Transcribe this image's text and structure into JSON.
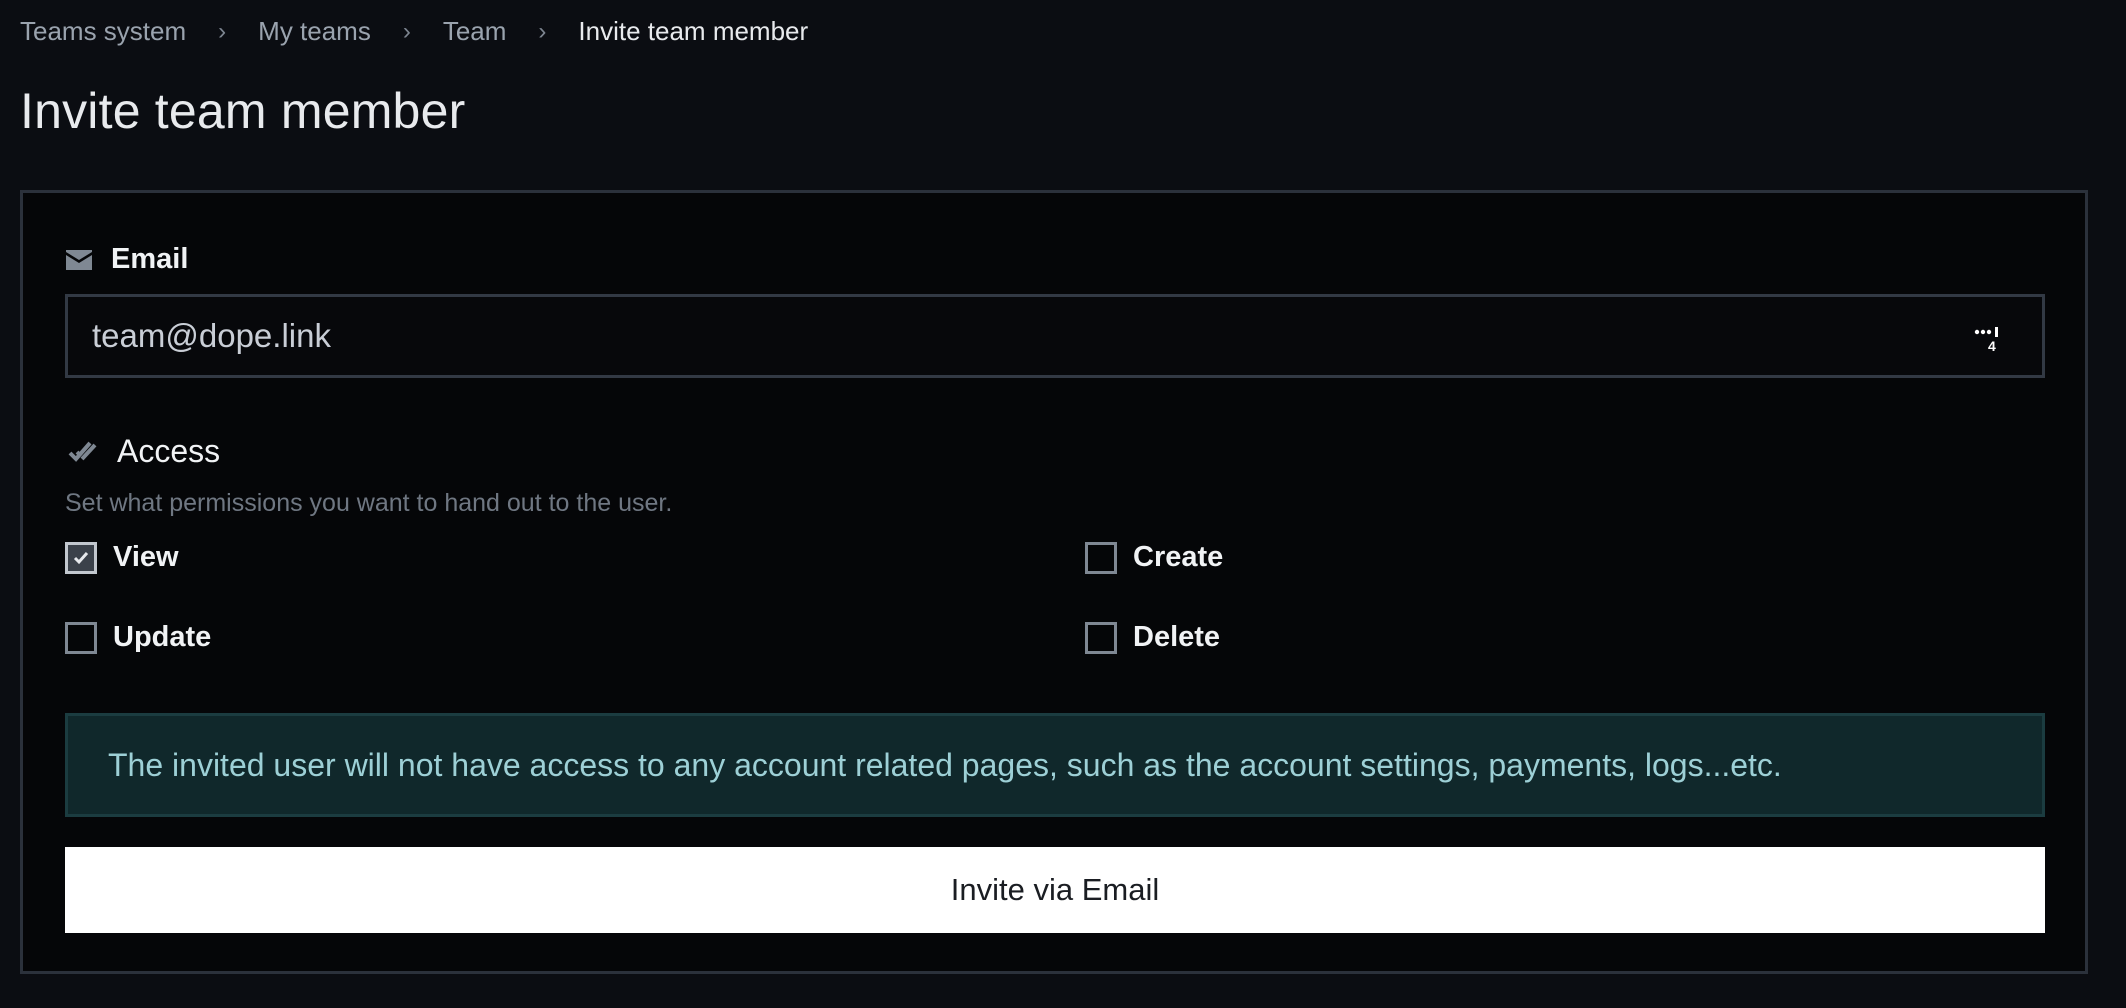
{
  "breadcrumb": {
    "items": [
      {
        "label": "Teams system"
      },
      {
        "label": "My teams"
      },
      {
        "label": "Team"
      },
      {
        "label": "Invite team member"
      }
    ],
    "separator": "›"
  },
  "page": {
    "title": "Invite team member"
  },
  "form": {
    "email": {
      "label": "Email",
      "icon": "envelope-icon",
      "value": "team@dope.link",
      "trailing_icon": "password-manager-icon",
      "trailing_badge": "4"
    },
    "access": {
      "label": "Access",
      "icon": "double-check-icon",
      "helper": "Set what permissions you want to hand out to the user.",
      "permissions": [
        {
          "label": "View",
          "checked": true
        },
        {
          "label": "Create",
          "checked": false
        },
        {
          "label": "Update",
          "checked": false
        },
        {
          "label": "Delete",
          "checked": false
        }
      ]
    },
    "notice": "The invited user will not have access to any account related pages, such as the account settings, payments, logs...etc.",
    "submit_label": "Invite via Email"
  },
  "colors": {
    "background": "#0b0d12",
    "panel": "#050608",
    "notice_bg": "#10282b",
    "notice_text": "#9dd0d6",
    "button_bg": "#ffffff"
  }
}
